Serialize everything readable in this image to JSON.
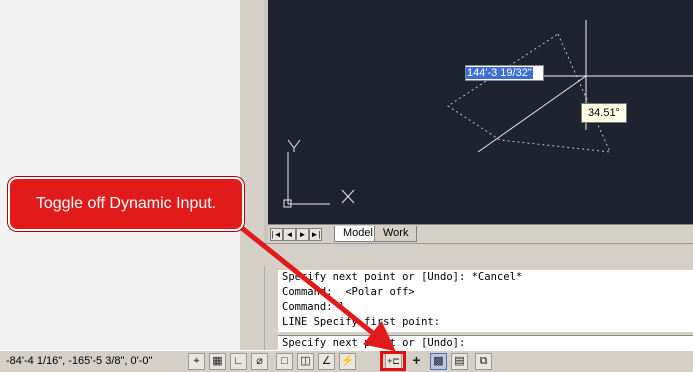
{
  "drawing": {
    "dynamic_input_value": "144'-3 19/32\"",
    "angle_tooltip": "34.51°",
    "ucs_labels": {
      "y": "Y",
      "x": "X"
    }
  },
  "layout_tabs": {
    "nav_buttons": [
      "|◄",
      "◄",
      "►",
      "►|"
    ],
    "tabs": [
      {
        "label": "Model",
        "active": true
      },
      {
        "label": "Work",
        "active": false
      }
    ]
  },
  "command_window": {
    "history": [
      "Specify next point or [Undo]: *Cancel*",
      "Command:  <Polar off>",
      "Command: l",
      "LINE Specify first point:"
    ],
    "current_prompt": "Specify next point or [Undo]:"
  },
  "status_bar": {
    "coordinates": "-84'-4 1/16\", -165'-5 3/8\", 0'-0\"",
    "buttons": [
      {
        "name": "snap-mode-icon",
        "glyph": "⌖",
        "on": false
      },
      {
        "name": "grid-display-icon",
        "glyph": "▦",
        "on": false
      },
      {
        "name": "ortho-mode-icon",
        "glyph": "∟",
        "on": false
      },
      {
        "name": "polar-tracking-icon",
        "glyph": "⌀",
        "on": false
      },
      {
        "name": "object-snap-icon",
        "glyph": "□",
        "on": false
      },
      {
        "name": "3d-object-snap-icon",
        "glyph": "◫",
        "on": false
      },
      {
        "name": "object-snap-tracking-icon",
        "glyph": "∠",
        "on": false
      },
      {
        "name": "dynamic-ucs-icon",
        "glyph": "⚡",
        "on": false
      },
      {
        "name": "dynamic-input-icon",
        "glyph": "+⊏",
        "on": false
      },
      {
        "name": "lineweight-icon",
        "glyph": "+",
        "on": false
      },
      {
        "name": "transparency-icon",
        "glyph": "▩",
        "on": true
      },
      {
        "name": "quick-properties-icon",
        "glyph": "▤",
        "on": false
      },
      {
        "name": "selection-cycling-icon",
        "glyph": "⧉",
        "on": false
      }
    ]
  },
  "callout": {
    "text": "Toggle off Dynamic Input.",
    "color": "#e11a1a"
  }
}
